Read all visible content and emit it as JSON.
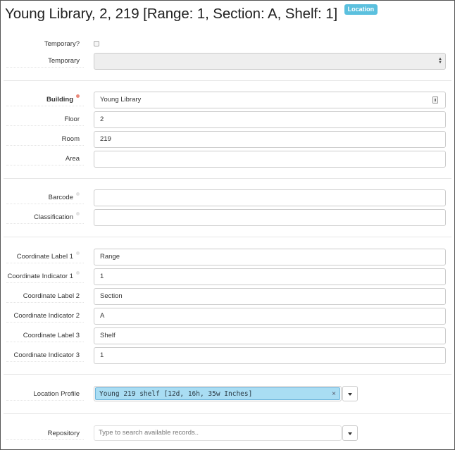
{
  "header": {
    "title": "Young Library, 2, 219 [Range: 1, Section: A, Shelf: 1]",
    "badge": "Location"
  },
  "temporary": {
    "checkbox_label": "Temporary?",
    "select_label": "Temporary",
    "select_value": ""
  },
  "fields": {
    "building": {
      "label": "Building",
      "value": "Young Library"
    },
    "floor": {
      "label": "Floor",
      "value": "2"
    },
    "room": {
      "label": "Room",
      "value": "219"
    },
    "area": {
      "label": "Area",
      "value": ""
    },
    "barcode": {
      "label": "Barcode",
      "value": ""
    },
    "classification": {
      "label": "Classification",
      "value": ""
    },
    "coordinate_label_1": {
      "label": "Coordinate Label 1",
      "value": "Range"
    },
    "coordinate_indicator_1": {
      "label": "Coordinate Indicator 1",
      "value": "1"
    },
    "coordinate_label_2": {
      "label": "Coordinate Label 2",
      "value": "Section"
    },
    "coordinate_indicator_2": {
      "label": "Coordinate Indicator 2",
      "value": "A"
    },
    "coordinate_label_3": {
      "label": "Coordinate Label 3",
      "value": "Shelf"
    },
    "coordinate_indicator_3": {
      "label": "Coordinate Indicator 3",
      "value": "1"
    }
  },
  "location_profile": {
    "label": "Location Profile",
    "token": "Young 219 shelf [12d, 16h, 35w Inches]",
    "remove_glyph": "×"
  },
  "repository": {
    "label": "Repository",
    "placeholder": "Type to search available records.."
  },
  "colors": {
    "badge": "#5bc0de",
    "token_bg": "#a9ddf3",
    "required_dot": "#e9897a"
  }
}
